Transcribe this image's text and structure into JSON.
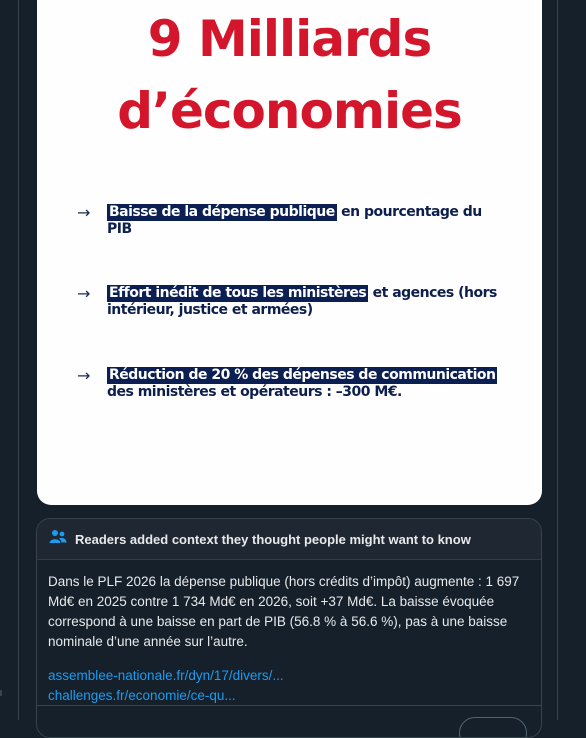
{
  "slide": {
    "headline_line1": "9 Milliards",
    "headline_line2": "d’économies",
    "bullets": [
      {
        "arrow": "→",
        "highlight": "Baisse de la dépense publique",
        "rest": " en pourcentage du PIB"
      },
      {
        "arrow": "→",
        "highlight": "Effort inédit de tous les ministères",
        "rest": " et agences (hors intérieur, justice et armées)"
      },
      {
        "arrow": "→",
        "highlight": "Réduction de 20 % des dépenses de communication",
        "rest": " des ministères et opérateurs : –300 M€."
      }
    ],
    "colors": {
      "headline": "#d3162b",
      "highlight_bg": "#0b1f52",
      "text": "#0d1f4d"
    }
  },
  "community_note": {
    "icon": "people-icon",
    "title": "Readers added context they thought people might want to know",
    "body": "Dans le PLF 2026 la dépense publique (hors crédits d’impôt) augmente : 1 697 Md€ en 2025 contre 1 734 Md€ en 2026, soit +37 Md€. La baisse évoquée correspond à une baisse en part de PIB (56.8 % à 56.6 %), pas à une baisse nominale d’une année sur l’autre.",
    "links": [
      "assemblee-nationale.fr/dyn/17/divers/...",
      "challenges.fr/economie/ce-qu..."
    ],
    "colors": {
      "link": "#1d9bf0",
      "background": "#15202b",
      "header": "#1e2732"
    }
  }
}
